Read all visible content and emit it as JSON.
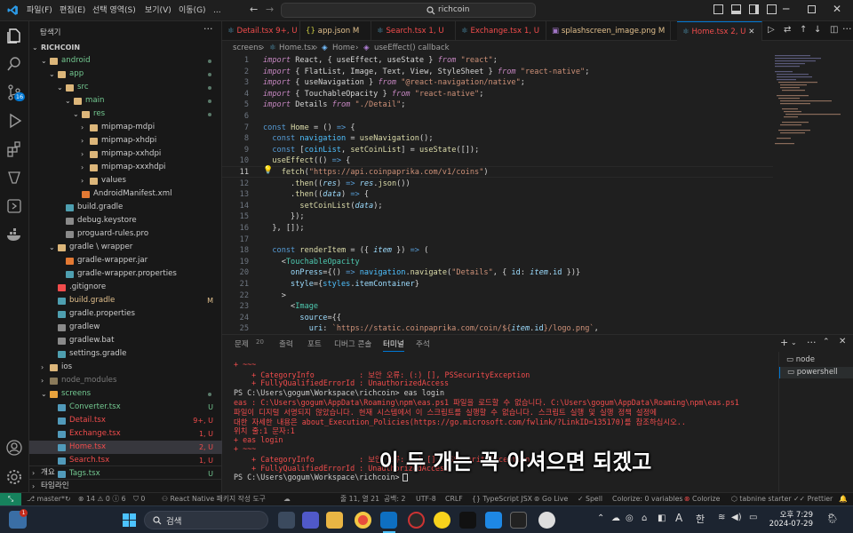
{
  "titlebar": {
    "menus": [
      "파일(F)",
      "편집(E)",
      "선택 영역(S)",
      "보기(V)",
      "이동(G)",
      "..."
    ],
    "search_text": "richcoin"
  },
  "sidebar": {
    "title": "탐색기",
    "root": "RICHCOIN",
    "items": [
      {
        "label": "android",
        "status": "",
        "dot": true
      },
      {
        "label": "app",
        "status": "",
        "dot": true
      },
      {
        "label": "src",
        "status": "",
        "dot": true
      },
      {
        "label": "main",
        "status": "",
        "dot": true
      },
      {
        "label": "res",
        "status": "",
        "dot": true
      },
      {
        "label": "mipmap-mdpi",
        "status": "",
        "dot": false
      },
      {
        "label": "mipmap-xhdpi",
        "status": "",
        "dot": false
      },
      {
        "label": "mipmap-xxhdpi",
        "status": "",
        "dot": false
      },
      {
        "label": "mipmap-xxxhdpi",
        "status": "",
        "dot": false
      },
      {
        "label": "values",
        "status": "",
        "dot": false
      },
      {
        "label": "AndroidManifest.xml",
        "status": "",
        "dot": false
      },
      {
        "label": "build.gradle",
        "status": "",
        "dot": false
      },
      {
        "label": "debug.keystore",
        "status": "",
        "dot": false
      },
      {
        "label": "proguard-rules.pro",
        "status": "",
        "dot": false
      },
      {
        "label": "gradle \\ wrapper",
        "status": "",
        "dot": false
      },
      {
        "label": "gradle-wrapper.jar",
        "status": "",
        "dot": false
      },
      {
        "label": "gradle-wrapper.properties",
        "status": "",
        "dot": false
      },
      {
        "label": ".gitignore",
        "status": "",
        "dot": false
      },
      {
        "label": "build.gradle",
        "status": "M",
        "dot": false
      },
      {
        "label": "gradle.properties",
        "status": "",
        "dot": false
      },
      {
        "label": "gradlew",
        "status": "",
        "dot": false
      },
      {
        "label": "gradlew.bat",
        "status": "",
        "dot": false
      },
      {
        "label": "settings.gradle",
        "status": "",
        "dot": false
      },
      {
        "label": "ios",
        "status": "",
        "dot": false
      },
      {
        "label": "node_modules",
        "status": "",
        "dot": false
      },
      {
        "label": "screens",
        "status": "",
        "dot": true
      },
      {
        "label": "Converter.tsx",
        "status": "U",
        "dot": false
      },
      {
        "label": "Detail.tsx",
        "status": "9+, U",
        "dot": false
      },
      {
        "label": "Exchange.tsx",
        "status": "1, U",
        "dot": false
      },
      {
        "label": "Home.tsx",
        "status": "2, U",
        "dot": false
      },
      {
        "label": "Search.tsx",
        "status": "1, U",
        "dot": false
      },
      {
        "label": "Tags.tsx",
        "status": "U",
        "dot": false
      }
    ],
    "outline": "개요",
    "timeline": "타임라인"
  },
  "tabs": [
    {
      "label": "Detail.tsx",
      "status": "9+, U"
    },
    {
      "label": "app.json",
      "status": "M"
    },
    {
      "label": "Search.tsx",
      "status": "1, U"
    },
    {
      "label": "Exchange.tsx",
      "status": "1, U"
    },
    {
      "label": "splashscreen_image.png",
      "status": "M"
    },
    {
      "label": "Home.tsx",
      "status": "2, U"
    }
  ],
  "breadcrumb": [
    "screens",
    "Home.tsx",
    "Home",
    "useEffect() callback"
  ],
  "editor": {
    "line_numbers": [
      "1",
      "2",
      "3",
      "4",
      "5",
      "6",
      "7",
      "8",
      "9",
      "10",
      "11",
      "12",
      "13",
      "14",
      "15",
      "16",
      "17",
      "18",
      "19",
      "20",
      "21",
      "22",
      "23",
      "24",
      "25"
    ]
  },
  "panel": {
    "tabs": [
      "문제",
      "20",
      "출력",
      "포트",
      "디버그 콘솔",
      "터미널",
      "주석"
    ],
    "terminal_lines": [
      "+ ~~~",
      "    + CategoryInfo          : 보안 오류: (:) [], PSSecurityException",
      "    + FullyQualifiedErrorId : UnauthorizedAccess",
      "PS C:\\Users\\gogum\\Workspace\\richcoin> eas login",
      "eas : C:\\Users\\gogum\\AppData\\Roaming\\npm\\eas.ps1 파일을 로드할 수 없습니다. C:\\Users\\gogum\\AppData\\Roaming\\npm\\eas.ps1",
      "파일이 디지털 서명되지 않았습니다. 현재 시스템에서 이 스크립트를 실행할 수 없습니다. 스크립트 실행 및 실행 정책 설정에",
      "대한 자세한 내용은 about_Execution_Policies(https://go.microsoft.com/fwlink/?LinkID=135170)를 참조하십시오..",
      "위치 줄:1 문자:1",
      "+ eas login",
      "+ ~~~",
      "    + CategoryInfo          : 보안 오류: (:) [], PSSecurityException",
      "    + FullyQualifiedErrorId : UnauthorizedAccess",
      "PS C:\\Users\\gogum\\Workspace\\richcoin> "
    ],
    "terminals": [
      "node",
      "powershell"
    ]
  },
  "caption": "이 두 개는 꼭 아셔으면 되겠고",
  "statusbar": {
    "branch": "master*",
    "problems": "⊗ 14 ⚠ 0 ⓘ 6",
    "ports": "0",
    "react_native": "React Native 패키지 작성 도구",
    "position": "줄 11, 열 21",
    "spaces": "공백: 2",
    "encoding": "UTF-8",
    "eol": "CRLF",
    "language": "{} TypeScript JSX",
    "golive": "Go Live",
    "spell": "Spell",
    "colorize_vars": "Colorize: 0 variables",
    "colorize": "Colorize",
    "tabnine": "tabnine starter",
    "prettier": "Prettier"
  },
  "taskbar": {
    "search": "검색",
    "lang1": "A",
    "lang2": "한",
    "time": "오후 7:29",
    "date": "2024-07-29",
    "badge": "1"
  },
  "colors": {
    "accent": "#0078d4",
    "untracked": "#73c991",
    "modified": "#e2c08d",
    "error": "#f14c4c"
  }
}
